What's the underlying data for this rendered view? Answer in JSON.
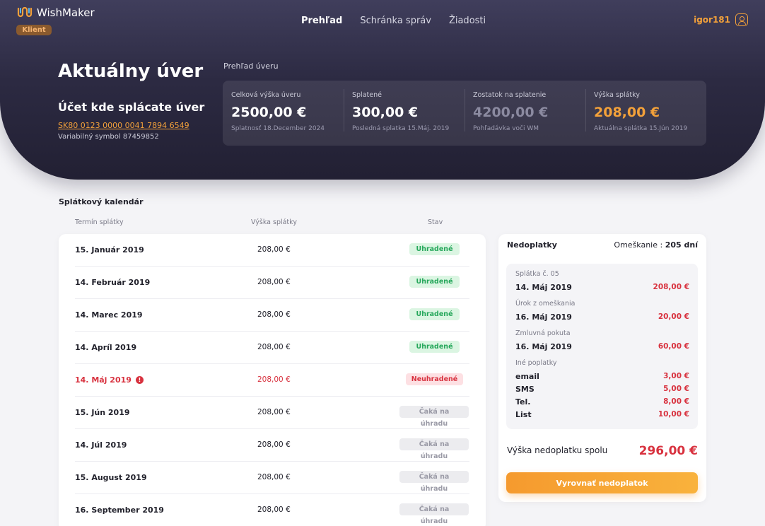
{
  "header": {
    "brand": "WishMaker",
    "role_badge": "Klient",
    "nav": [
      "Prehľad",
      "Schránka správ",
      "Žiadosti"
    ],
    "username": "igor181"
  },
  "loan": {
    "title": "Aktuálny úver",
    "account_title": "Účet kde splácate úver",
    "iban": "SK80 0123 0000 0041 7894 6549",
    "variable_symbol": "Variabilný symbol 87459852"
  },
  "overview": {
    "label": "Prehľad úveru",
    "items": [
      {
        "label": "Celková výška úveru",
        "value": "2500,00 €",
        "sub": "Splatnosť 18.December 2024"
      },
      {
        "label": "Splatené",
        "value": "300,00 €",
        "sub": "Posledná splatka 15.Máj. 2019"
      },
      {
        "label": "Zostatok na splatenie",
        "value": "4200,00 €",
        "sub": "Pohľadávka voči WM"
      },
      {
        "label": "Výška splátky",
        "value": "208,00 €",
        "sub": "Aktuálna splátka 15.Jún 2019"
      }
    ]
  },
  "calendar": {
    "title": "Splátkový kalendár",
    "columns": [
      "Termín splátky",
      "Výška splátky",
      "Stav"
    ],
    "rows": [
      {
        "date": "15. Január 2019",
        "amount": "208,00 €",
        "status": "Uhradené"
      },
      {
        "date": "14. Február 2019",
        "amount": "208,00 €",
        "status": "Uhradené"
      },
      {
        "date": "14. Marec 2019",
        "amount": "208,00 €",
        "status": "Uhradené"
      },
      {
        "date": "14. Apríl 2019",
        "amount": "208,00 €",
        "status": "Uhradené"
      },
      {
        "date": "14. Máj 2019",
        "amount": "208,00 €",
        "status": "Neuhradené"
      },
      {
        "date": "15. Jún 2019",
        "amount": "208,00 €",
        "status": "Čaká na úhradu"
      },
      {
        "date": "14. Júl 2019",
        "amount": "208,00 €",
        "status": "Čaká na úhradu"
      },
      {
        "date": "15. August 2019",
        "amount": "208,00 €",
        "status": "Čaká na úhradu"
      },
      {
        "date": "16. September 2019",
        "amount": "208,00 €",
        "status": "Čaká na úhradu"
      }
    ]
  },
  "arrears": {
    "title": "Nedoplatky",
    "delay_label": "Omeškanie : ",
    "delay_value": "205 dní",
    "installment_label": "Splátka č. 05",
    "installment_date": "14. Máj 2019",
    "installment_value": "208,00 €",
    "interest_label": "Úrok z omeškania",
    "interest_date": "16. Máj 2019",
    "interest_value": "20,00 €",
    "penalty_label": "Zmluvná pokuta",
    "penalty_date": "16. Máj 2019",
    "penalty_value": "60,00 €",
    "other_label": "Iné poplatky",
    "fees": [
      {
        "name": "email",
        "value": "3,00 €"
      },
      {
        "name": "SMS",
        "value": "5,00 €"
      },
      {
        "name": "Tel.",
        "value": "8,00 €"
      },
      {
        "name": "List",
        "value": "10,00 €"
      }
    ],
    "total_label": "Výška nedoplatku spolu",
    "total_value": "296,00 €",
    "button": "Vyrovnať nedoplatok"
  },
  "colors": {
    "accent": "#f3a13a",
    "danger": "#d8323f",
    "success": "#25a75a",
    "header_bg": "#2c2a42"
  }
}
